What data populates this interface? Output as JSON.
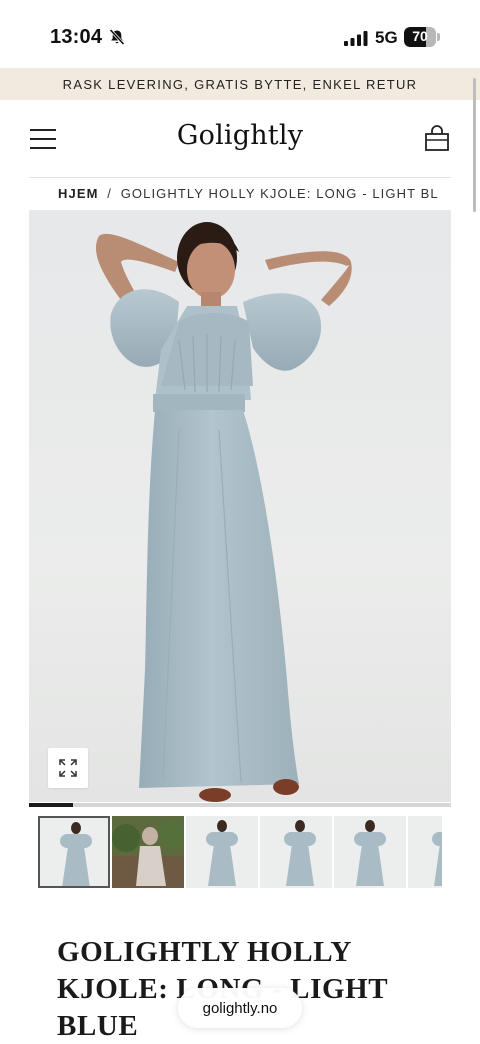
{
  "status_bar": {
    "time": "13:04",
    "network": "5G",
    "battery": "70",
    "battery_level": 0.7,
    "icons": [
      "bell-slash-icon",
      "cellular-signal-icon",
      "battery-icon"
    ]
  },
  "announcement": {
    "text": "RASK LEVERING, GRATIS BYTTE, ENKEL RETUR",
    "background": "#f2e9df"
  },
  "header": {
    "logo": "Golightly",
    "icons": [
      "hamburger-menu-icon",
      "shopping-bag-icon"
    ]
  },
  "breadcrumb": {
    "home": "HJEM",
    "separator": "/",
    "current": "GOLIGHTLY HOLLY KJOLE: LONG - LIGHT BLU..."
  },
  "gallery": {
    "expand_icon": "expand-icon",
    "image_index": 1,
    "image_count": 6,
    "dress_color": "#a9bcc6",
    "thumbnails": [
      {
        "scene": "studio"
      },
      {
        "scene": "garden"
      },
      {
        "scene": "studio"
      },
      {
        "scene": "studio"
      },
      {
        "scene": "studio"
      },
      {
        "scene": "studio"
      }
    ]
  },
  "product": {
    "title": "GOLIGHTLY HOLLY KJOLE: LONG - LIGHT BLUE"
  },
  "browser": {
    "url": "golightly.no"
  }
}
